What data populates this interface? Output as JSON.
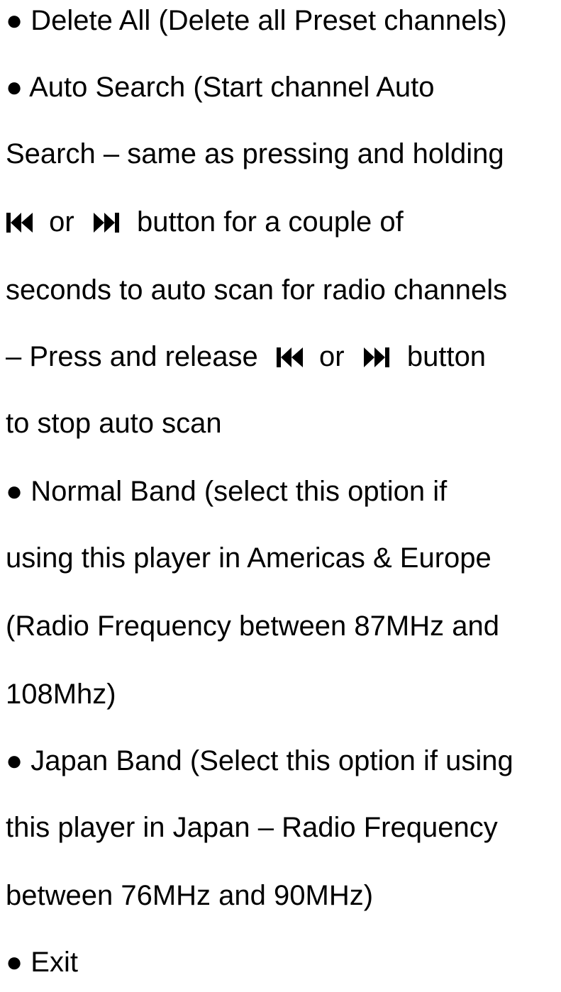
{
  "lines": {
    "l1": "● Delete All (Delete all Preset channels)",
    "l2": "● Auto Search (Start channel Auto",
    "l3": "Search – same as pressing and holding",
    "l4_or": "or",
    "l4_tail": "button for a couple of",
    "l5": "seconds to auto scan for radio channels",
    "l6_head": "– Press and release",
    "l6_or": "or",
    "l6_tail": "button",
    "l7": "to stop auto scan",
    "l8": "● Normal Band (select this option if",
    "l9": "using this player in Americas & Europe",
    "l10": "(Radio Frequency between 87MHz and",
    "l11": "108Mhz)",
    "l12": "● Japan Band (Select this option if using",
    "l13": "this player in Japan – Radio Frequency",
    "l14": "between 76MHz and 90MHz)",
    "l15": "● Exit"
  },
  "icons": {
    "previous": "skip-previous-icon",
    "next": "skip-next-icon"
  },
  "colors": {
    "text": "#000000",
    "background": "#ffffff"
  }
}
